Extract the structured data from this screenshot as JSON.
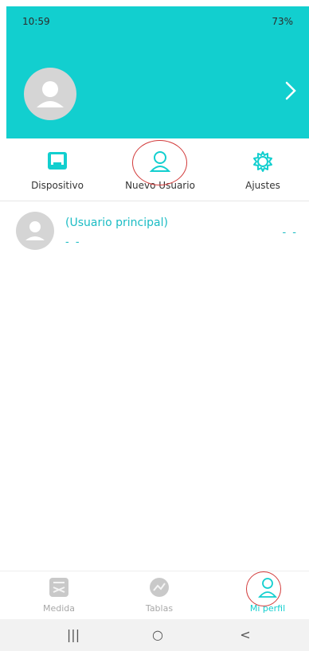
{
  "status_bar": {
    "time": "10:59",
    "right_text": "73%"
  },
  "quick_actions": {
    "device": "Dispositivo",
    "new_user": "Nuevo Usuario",
    "settings": "Ajustes"
  },
  "user": {
    "name": "(Usuario principal)",
    "subtitle": "- -",
    "right_value": "- -"
  },
  "bottom_tabs": [
    {
      "label": "Medida",
      "icon": "scale-icon"
    },
    {
      "label": "Tablas",
      "icon": "chart-icon"
    },
    {
      "label": "Mi perfil",
      "icon": "profile-icon"
    }
  ],
  "system_nav": {
    "recent": "|||",
    "home": "○",
    "back": "<"
  },
  "colors": {
    "accent": "#12cfcf",
    "accent_text": "#1bbcc4",
    "annotation": "#d23a3a"
  }
}
